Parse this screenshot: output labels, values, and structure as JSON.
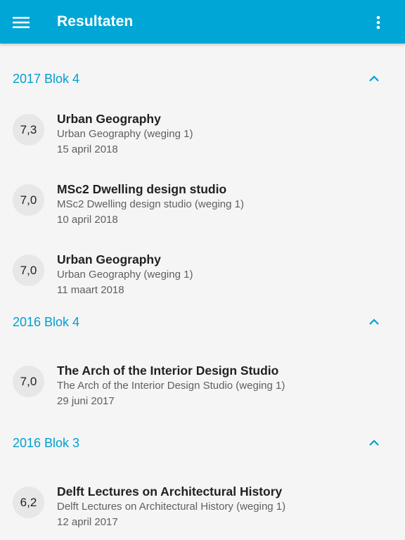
{
  "appbar": {
    "title": "Resultaten",
    "menu_icon": "hamburger-icon",
    "more_icon": "more-vert-icon",
    "background": "#00a6d6"
  },
  "accent_color": "#00a0cf",
  "sections": [
    {
      "title": "2017 Blok 4",
      "expanded": true,
      "items": [
        {
          "grade": "7,3",
          "title": "Urban Geography",
          "subtitle": "Urban Geography (weging 1)",
          "date": "15 april 2018"
        },
        {
          "grade": "7,0",
          "title": "MSc2 Dwelling design studio",
          "subtitle": "MSc2 Dwelling design studio (weging 1)",
          "date": "10 april 2018"
        },
        {
          "grade": "7,0",
          "title": "Urban Geography",
          "subtitle": "Urban Geography (weging 1)",
          "date": "11 maart 2018"
        }
      ]
    },
    {
      "title": "2016 Blok 4",
      "expanded": true,
      "items": [
        {
          "grade": "7,0",
          "title": "The Arch of the Interior Design Studio",
          "subtitle": "The Arch of the Interior Design Studio (weging 1)",
          "date": "29 juni 2017"
        }
      ]
    },
    {
      "title": "2016 Blok 3",
      "expanded": true,
      "items": [
        {
          "grade": "6,2",
          "title": "Delft Lectures on Architectural History",
          "subtitle": "Delft Lectures on Architectural History (weging 1)",
          "date": "12 april 2017"
        }
      ]
    }
  ]
}
